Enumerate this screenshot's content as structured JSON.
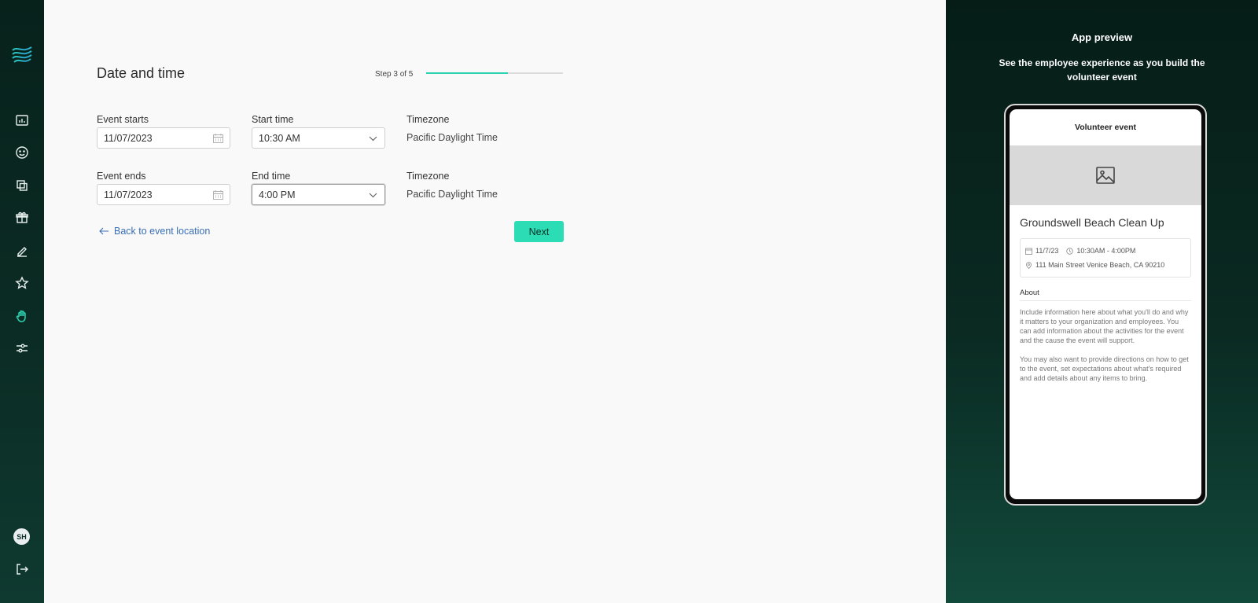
{
  "sidebar": {
    "items": [
      {
        "icon": "chart-icon"
      },
      {
        "icon": "smiley-icon"
      },
      {
        "icon": "copy-icon"
      },
      {
        "icon": "gift-icon"
      },
      {
        "icon": "pen-icon"
      },
      {
        "icon": "star-icon"
      },
      {
        "icon": "hand-icon",
        "active": true
      },
      {
        "icon": "sliders-icon"
      }
    ],
    "avatar_initials": "SH",
    "accent_color": "#2bd3b0"
  },
  "form": {
    "title": "Date and time",
    "step_label": "Step 3 of 5",
    "progress": 0.6,
    "start": {
      "date_label": "Event starts",
      "date_value": "11/07/2023",
      "time_label": "Start time",
      "time_value": "10:30 AM",
      "tz_label": "Timezone",
      "tz_value": "Pacific Daylight Time"
    },
    "end": {
      "date_label": "Event ends",
      "date_value": "11/07/2023",
      "time_label": "End time",
      "time_value": "4:00 PM",
      "tz_label": "Timezone",
      "tz_value": "Pacific Daylight Time"
    },
    "back_label": "Back to event location",
    "next_label": "Next"
  },
  "preview": {
    "title": "App preview",
    "subtitle": "See the employee experience as you build the volunteer event",
    "screen_header": "Volunteer event",
    "event_title": "Groundswell Beach Clean Up",
    "date": "11/7/23",
    "time": "10:30AM - 4:00PM",
    "address": "111 Main Street Venice Beach, CA 90210",
    "about_heading": "About",
    "about_p1": "Include information here about what you'll do and why it matters to your organization and employees. You can add information about the activities for the event and the cause the event will support.",
    "about_p2": "You may also want to provide directions on how to get to the event, set expectations about what's required and add details about any items to bring."
  }
}
